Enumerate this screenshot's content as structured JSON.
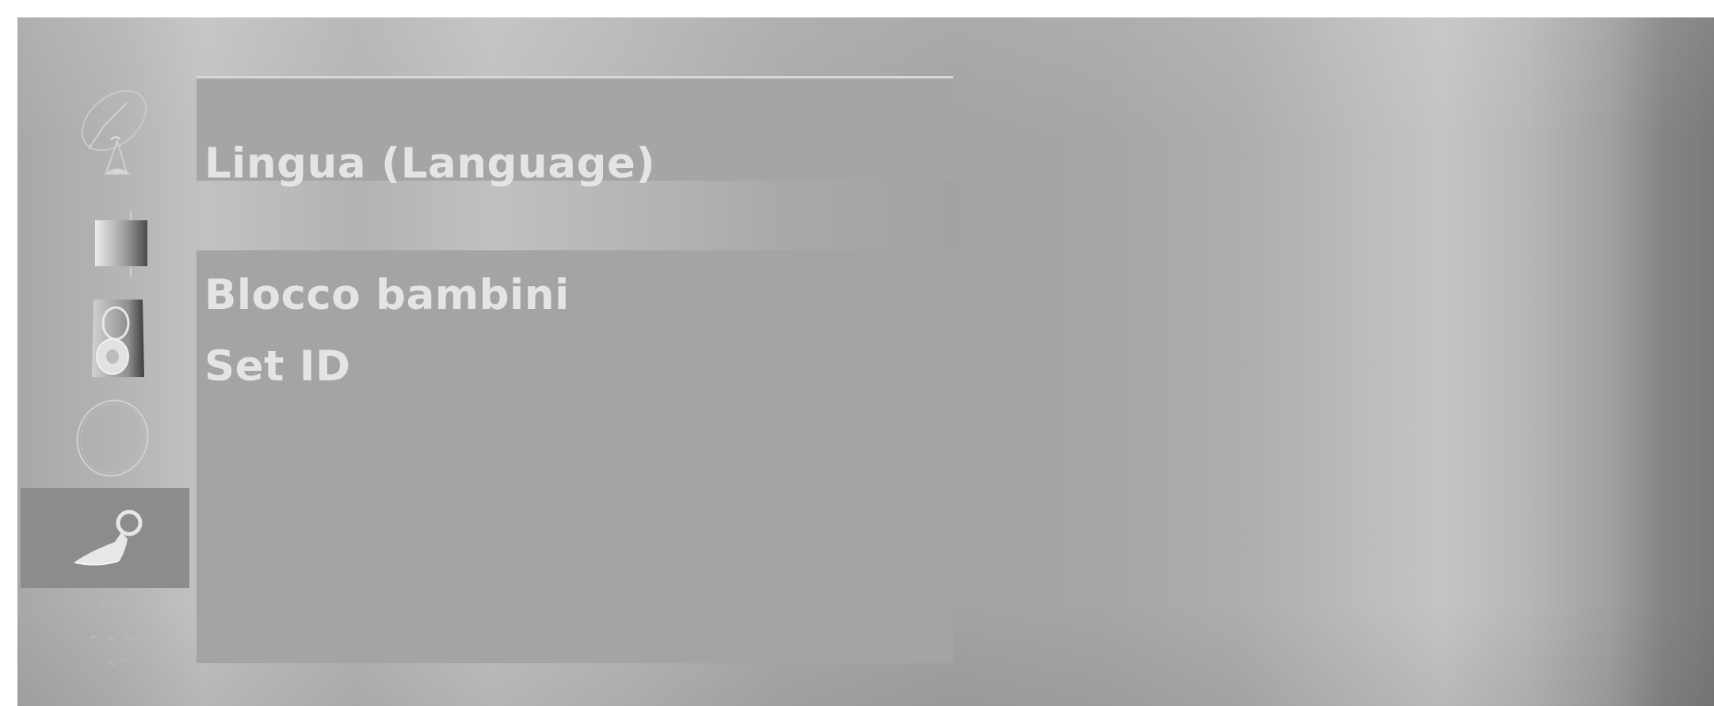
{
  "menu": {
    "top_items": [
      {
        "label": "Lingua (Language)"
      }
    ],
    "bottom_items": [
      {
        "label": "Blocco bambini"
      },
      {
        "label": "Set ID"
      }
    ]
  },
  "sidebar": {
    "icons": [
      {
        "name": "satellite-dish-icon"
      },
      {
        "name": "picture-icon"
      },
      {
        "name": "audio-speaker-icon"
      },
      {
        "name": "timer-icon"
      },
      {
        "name": "special-key-icon",
        "selected": true
      }
    ]
  },
  "colors": {
    "panel": "#a5a5a5",
    "selected_tab": "#8c8c8c",
    "text": "#e4e4e4"
  }
}
